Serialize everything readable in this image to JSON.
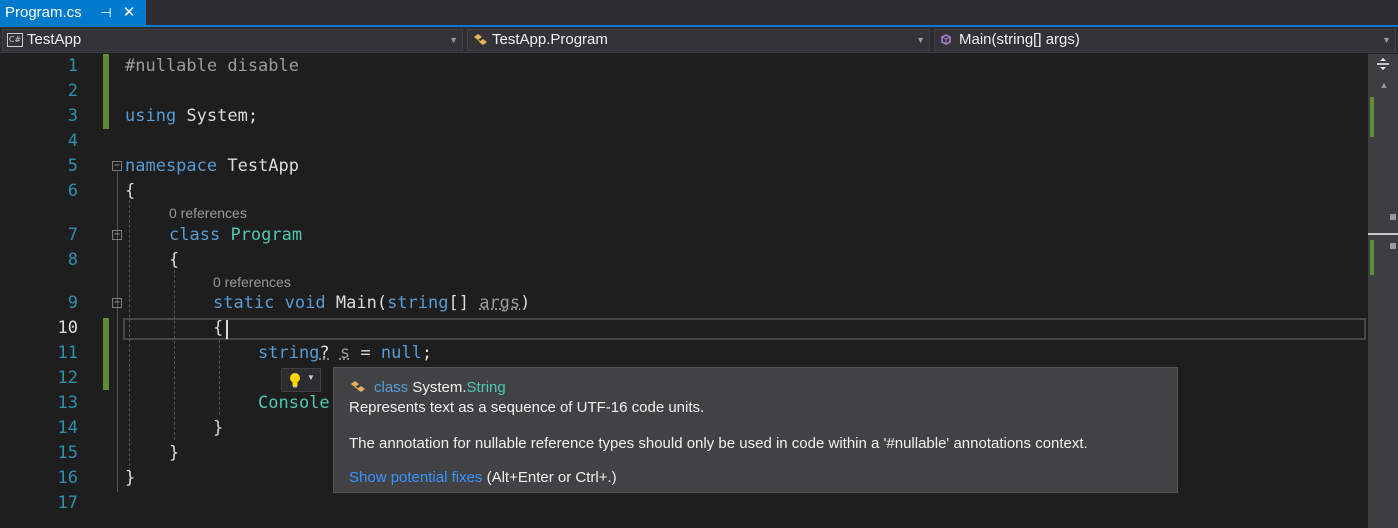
{
  "tab": {
    "title": "Program.cs",
    "pin_glyph": "⊣",
    "close_glyph": "✕"
  },
  "nav": {
    "project": "TestApp",
    "type": "TestApp.Program",
    "member": "Main(string[] args)",
    "project_icon_text": "C#"
  },
  "line_numbers": [
    "1",
    "2",
    "3",
    "4",
    "5",
    "6",
    "7",
    "8",
    "9",
    "10",
    "11",
    "12",
    "13",
    "14",
    "15",
    "16",
    "17"
  ],
  "code": {
    "l1": "#nullable disable",
    "l3_kw": "using",
    "l3_rest": " System;",
    "l5_kw": "namespace",
    "l5_rest": " TestApp",
    "l6": "{",
    "lens_class": "0 references",
    "l7_kw": "class",
    "l7_ty": "Program",
    "l8": "{",
    "lens_main": "0 references",
    "l9_kw1": "static",
    "l9_kw2": "void",
    "l9_name": "Main(",
    "l9_kw3": "string",
    "l9_rest": "[] ",
    "l9_arg": "args",
    "l9_close": ")",
    "l10": "{",
    "l11_kw": "string",
    "l11_q": "?",
    "l11_var": "s",
    "l11_eq": " = ",
    "l11_null": "null",
    "l11_semi": ";",
    "l13_ty": "Console",
    "l14": "}",
    "l15": "}",
    "l16": "}"
  },
  "tooltip": {
    "kw": "class",
    "ns": "System.",
    "type": "String",
    "summary": "Represents text as a sequence of UTF-16 code units.",
    "message": "The annotation for nullable reference types should only be used in code within a '#nullable' annotations context.",
    "link": "Show potential fixes",
    "shortcut": " (Alt+Enter or Ctrl+.)"
  },
  "colors": {
    "accent": "#007acc",
    "keyword": "#569cd6",
    "type": "#4ec9b0",
    "line_number": "#2b91af",
    "change_bar": "#5e8d3a",
    "link": "#3794ff"
  },
  "icons": {
    "lightbulb": "lightbulb-icon",
    "class": "class-icon",
    "method": "method-icon",
    "csharp": "csharp-project-icon"
  }
}
